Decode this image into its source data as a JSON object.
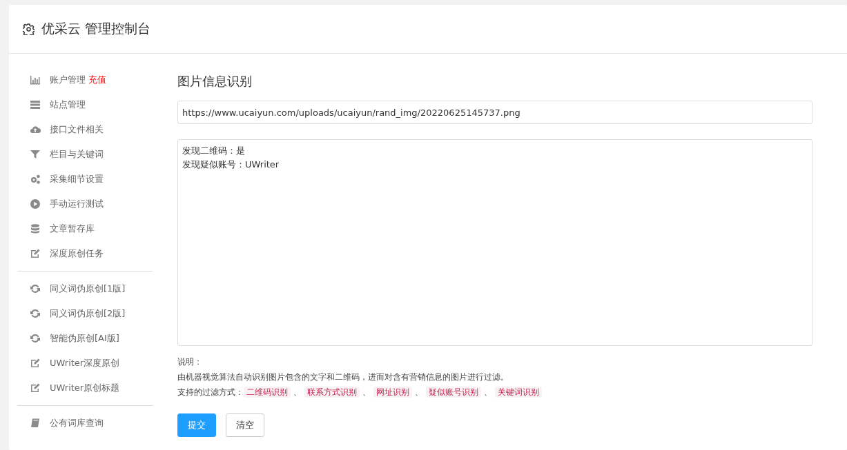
{
  "header": {
    "title": "优采云 管理控制台"
  },
  "sidebar": {
    "groups": [
      {
        "items": [
          {
            "label": "账户管理",
            "badge": "充值",
            "kind": "chart"
          },
          {
            "label": "站点管理",
            "kind": "server"
          },
          {
            "label": "接口文件相关",
            "kind": "cloud"
          },
          {
            "label": "栏目与关键词",
            "kind": "filter"
          },
          {
            "label": "采集细节设置",
            "kind": "gears"
          },
          {
            "label": "手动运行测试",
            "kind": "play"
          },
          {
            "label": "文章暂存库",
            "kind": "database"
          },
          {
            "label": "深度原创任务",
            "kind": "edit"
          }
        ]
      },
      {
        "items": [
          {
            "label": "同义词伪原创[1版]",
            "kind": "refresh"
          },
          {
            "label": "同义词伪原创[2版]",
            "kind": "refresh"
          },
          {
            "label": "智能伪原创[AI版]",
            "kind": "refresh"
          },
          {
            "label": "UWriter深度原创",
            "kind": "edit"
          },
          {
            "label": "UWriter原创标题",
            "kind": "edit"
          }
        ]
      },
      {
        "items": [
          {
            "label": "公有词库查询",
            "kind": "book"
          }
        ]
      }
    ]
  },
  "main": {
    "title": "图片信息识别",
    "url_field": {
      "value": "https://www.ucaiyun.com/uploads/ucaiyun/rand_img/20220625145737.png"
    },
    "result_box": {
      "lines": [
        "发现二维码：是",
        "发现疑似账号：UWriter"
      ]
    },
    "notes": {
      "heading": "说明：",
      "description": "由机器视觉算法自动识别图片包含的文字和二维码，进而对含有营销信息的图片进行过滤。",
      "methods_label": "支持的过滤方式：",
      "separator": "、",
      "methods": [
        "二维码识别",
        "联系方式识别",
        "网址识别",
        "疑似账号识别",
        "关键词识别"
      ]
    },
    "buttons": [
      {
        "label": "提交",
        "kind": "primary"
      },
      {
        "label": "清空",
        "kind": "default"
      }
    ]
  }
}
